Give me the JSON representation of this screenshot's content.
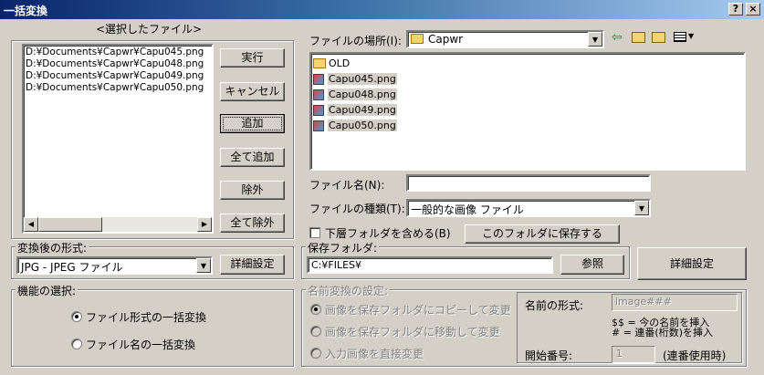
{
  "window": {
    "title": "一括変換",
    "help_label": "?",
    "close_label": "×"
  },
  "selected": {
    "header": "<選択したファイル>",
    "files": [
      "D:¥Documents¥Capwr¥Capu045.png",
      "D:¥Documents¥Capwr¥Capu048.png",
      "D:¥Documents¥Capwr¥Capu049.png",
      "D:¥Documents¥Capwr¥Capu050.png"
    ],
    "buttons": {
      "run": "実行",
      "cancel": "キャンセル",
      "add": "追加",
      "add_all": "全て追加",
      "remove": "除外",
      "remove_all": "全て除外"
    }
  },
  "browser": {
    "location_label": "ファイルの場所(I):",
    "location_value": "Capwr",
    "items": [
      {
        "name": "OLD",
        "kind": "folder"
      },
      {
        "name": "Capu045.png",
        "kind": "image"
      },
      {
        "name": "Capu048.png",
        "kind": "image"
      },
      {
        "name": "Capu049.png",
        "kind": "image"
      },
      {
        "name": "Capu050.png",
        "kind": "image"
      }
    ],
    "filename_label": "ファイル名(N):",
    "filename_value": "",
    "filetype_label": "ファイルの種類(T):",
    "filetype_value": "一般的な画像 ファイル",
    "subfolder_label": "下層フォルダを含める(B)",
    "save_here_button": "このフォルダに保存する"
  },
  "format": {
    "group_label": "変換後の形式:",
    "value": "JPG - JPEG ファイル",
    "detail_button": "詳細設定"
  },
  "save_folder": {
    "group_label": "保存フォルダ:",
    "value": "C:¥FILES¥",
    "browse_button": "参照"
  },
  "detail_button_big": "詳細設定",
  "function": {
    "group_label": "機能の選択:",
    "options": [
      "ファイル形式の一括変換",
      "ファイル名の一括変換"
    ]
  },
  "rename": {
    "group_label": "名前変換の設定:",
    "options": [
      "画像を保存フォルダにコピーして変更",
      "画像を保存フォルダに移動して変更",
      "入力画像を直接変更"
    ],
    "name_format_label": "名前の形式:",
    "name_format_value": "image###",
    "hint1": "$$ = 今の名前を挿入",
    "hint2": "# = 連番(桁数)を挿入",
    "start_label": "開始番号:",
    "start_value": "1",
    "start_note": "(連番使用時)"
  }
}
